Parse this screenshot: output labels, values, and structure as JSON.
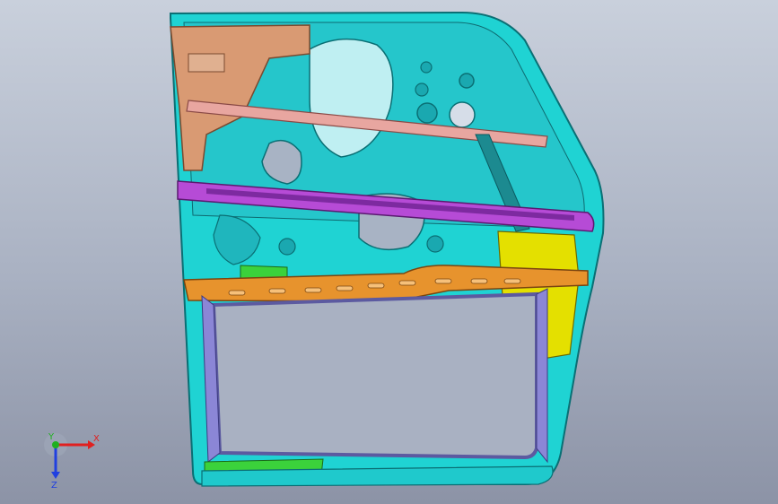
{
  "viewport": {
    "background_top": "#c9d0dc",
    "background_bottom": "#8c93a6"
  },
  "model": {
    "colors": {
      "door_frame": "#1fd3d3",
      "door_frame_edge": "#0a6f74",
      "inner_panel": "#23c3c7",
      "bracket_peach": "#d99a73",
      "rail_purple": "#b64bd6",
      "beam_orange": "#e7932d",
      "reinforcement_yellow": "#e4e000",
      "rod_pink": "#e8a6a0",
      "lower_green": "#3bd23b",
      "window_frame": "#7f7ad0"
    }
  },
  "triad": {
    "x_label": "X",
    "y_label": "Y",
    "z_label": "Z",
    "x_color": "#e02020",
    "y_color": "#20b020",
    "z_color": "#2040e0"
  }
}
